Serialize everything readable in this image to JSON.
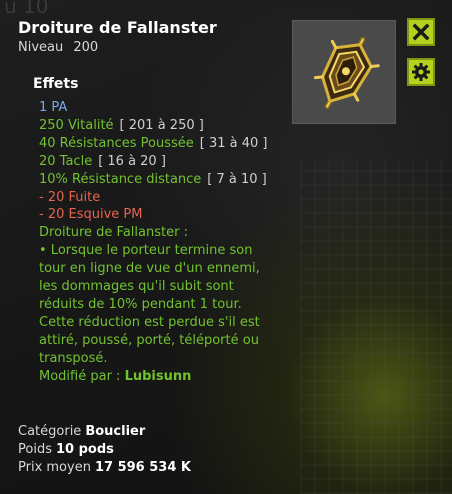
{
  "background_ghost_text": "u 10",
  "item": {
    "name": "Droiture de Fallanster",
    "level_label": "Niveau",
    "level_value": "200"
  },
  "effects_title": "Effets",
  "effects": [
    {
      "text": "1 PA",
      "range": "",
      "color": "blue"
    },
    {
      "text": "250 Vitalité",
      "range": "[ 201 à 250 ]",
      "color": "green"
    },
    {
      "text": "40 Résistances Poussée",
      "range": "[ 31 à 40 ]",
      "color": "green"
    },
    {
      "text": "20 Tacle",
      "range": "[ 16 à 20 ]",
      "color": "green"
    },
    {
      "text": "10% Résistance distance",
      "range": "[ 7 à 10 ]",
      "color": "green"
    },
    {
      "text": "- 20 Fuite",
      "range": "",
      "color": "red"
    },
    {
      "text": "- 20 Esquive PM",
      "range": "",
      "color": "red"
    }
  ],
  "description": {
    "title": "Droiture de Fallanster :",
    "text": "• Lorsque le porteur termine son tour en ligne de vue d'un ennemi, les dommages qu'il subit sont réduits de 10% pendant 1 tour. Cette réduction est perdue s'il est attiré, poussé, porté, téléporté ou transposé.",
    "modified_label": "Modifié par :",
    "modified_by": "Lubisunn"
  },
  "stats": {
    "category_label": "Catégorie",
    "category_value": "Bouclier",
    "weight_label": "Poids",
    "weight_value": "10 pods",
    "price_label": "Prix moyen",
    "price_value": "17 596 534 K"
  },
  "colors": {
    "blue": "#79a7f0",
    "green": "#72c22f",
    "red": "#e8624f",
    "button_accent": "#b5d11f"
  },
  "icons": {
    "close": "close-icon",
    "settings": "gear-icon",
    "item": "shield-icon"
  }
}
